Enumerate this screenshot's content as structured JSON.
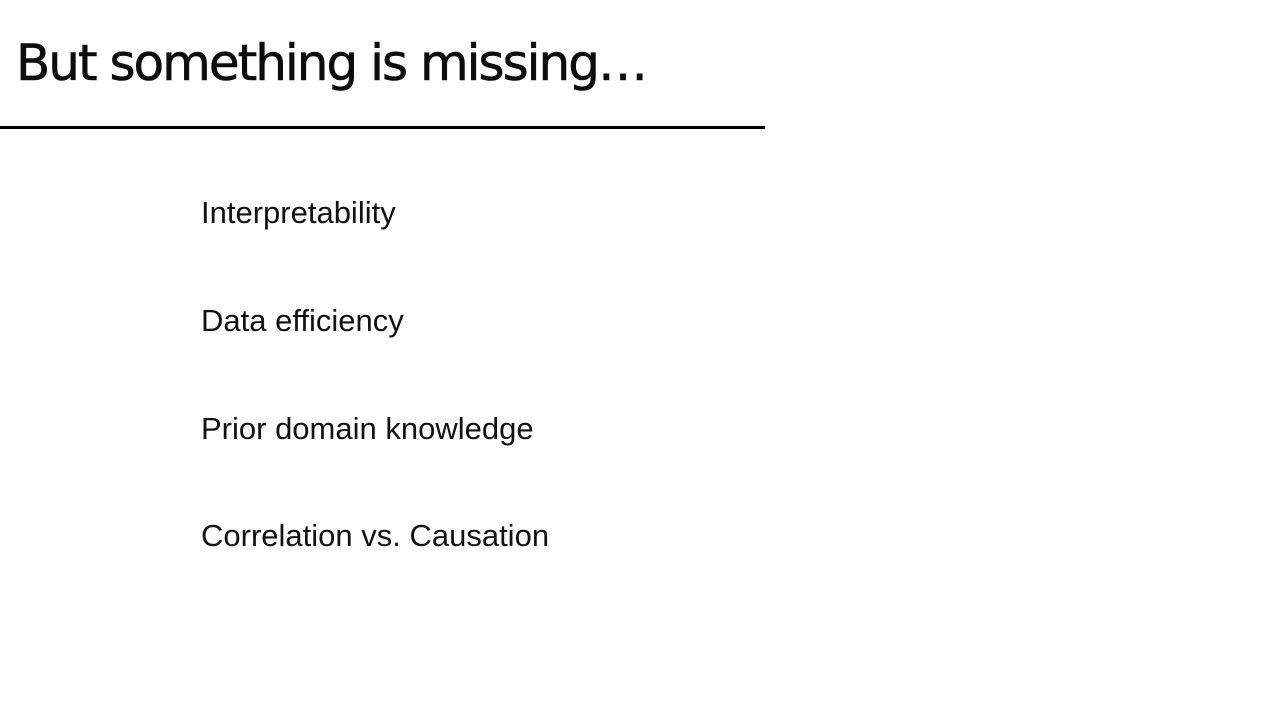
{
  "slide": {
    "title": "But something is missing…",
    "bullets": [
      "Interpretability",
      "Data efficiency",
      "Prior domain knowledge",
      "Correlation vs. Causation"
    ]
  }
}
